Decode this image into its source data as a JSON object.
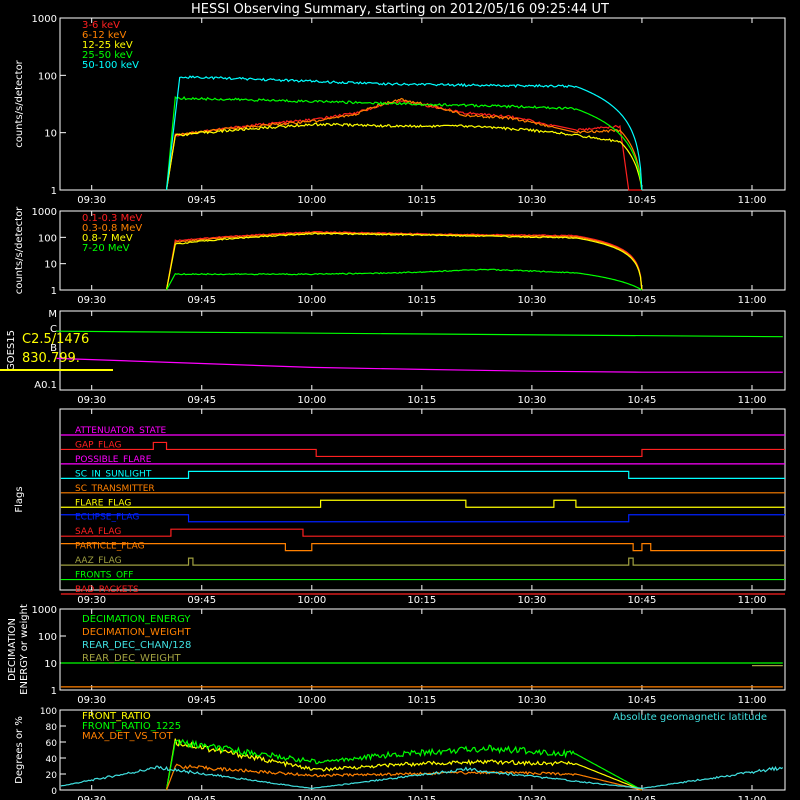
{
  "title": "HESSI Observing Summary, starting on 2012/05/16 09:25:44 UT",
  "time_ticks": [
    "09:30",
    "09:45",
    "10:00",
    "10:15",
    "10:30",
    "10:45",
    "11:00"
  ],
  "colors": {
    "background": "#000000",
    "axes": "#ffffff",
    "red": "#ff2020",
    "orange": "#ff8000",
    "yellow": "#ffff00",
    "green": "#00ff00",
    "cyan": "#00ffff",
    "magenta": "#ff00ff",
    "blue": "#0020ff",
    "olive": "#a0a040",
    "lightcyan": "#40e0e0"
  },
  "chart_data": [
    {
      "type": "line",
      "id": "xray",
      "ylabel": "counts/s/detector",
      "yscale": "log",
      "ylim": [
        1,
        1000
      ],
      "yticks": [
        "1",
        "10",
        "100",
        "1000"
      ],
      "series": [
        {
          "name": "3-6 keV",
          "color": "#ff2020",
          "x": [
            9.67,
            9.69,
            10.01,
            10.1,
            10.2,
            10.35,
            10.45,
            10.55,
            10.6,
            10.7,
            10.72,
            10.75
          ],
          "y": [
            1,
            9,
            17,
            22,
            35,
            22,
            19,
            13,
            11,
            13,
            1,
            1
          ]
        },
        {
          "name": "6-12 keV",
          "color": "#ff8000",
          "x": [
            9.67,
            9.69,
            10.01,
            10.1,
            10.2,
            10.35,
            10.45,
            10.55,
            10.6,
            10.7,
            10.75
          ],
          "y": [
            1,
            9,
            16,
            21,
            38,
            20,
            18,
            12,
            10,
            11,
            1
          ]
        },
        {
          "name": "12-25 keV",
          "color": "#ffff00",
          "x": [
            9.67,
            9.69,
            10.01,
            10.2,
            10.35,
            10.5,
            10.6,
            10.7,
            10.75
          ],
          "y": [
            1,
            9,
            14,
            13,
            13,
            11,
            9,
            7,
            1
          ]
        },
        {
          "name": "25-50 keV",
          "color": "#00ff00",
          "x": [
            9.67,
            9.69,
            10.01,
            10.2,
            10.35,
            10.5,
            10.6,
            10.75
          ],
          "y": [
            1,
            40,
            35,
            32,
            30,
            28,
            26,
            1
          ]
        },
        {
          "name": "50-100 keV",
          "color": "#00ffff",
          "x": [
            9.67,
            9.7,
            10.01,
            10.15,
            10.3,
            10.45,
            10.6,
            10.75
          ],
          "y": [
            1,
            95,
            78,
            72,
            68,
            66,
            64,
            1
          ]
        }
      ]
    },
    {
      "type": "line",
      "id": "gamma",
      "ylabel": "counts/s/detector",
      "yscale": "log",
      "ylim": [
        1,
        1000
      ],
      "yticks": [
        "1",
        "10",
        "100",
        "1000"
      ],
      "series": [
        {
          "name": "0.1-0.3 MeV",
          "color": "#ff2020",
          "x": [
            9.67,
            9.69,
            10.01,
            10.3,
            10.6,
            10.75
          ],
          "y": [
            1,
            75,
            160,
            130,
            115,
            1
          ]
        },
        {
          "name": "0.3-0.8 MeV",
          "color": "#ff8000",
          "x": [
            9.67,
            9.69,
            10.01,
            10.3,
            10.6,
            10.75
          ],
          "y": [
            1,
            65,
            150,
            125,
            105,
            1
          ]
        },
        {
          "name": "0.8-7 MeV",
          "color": "#ffff00",
          "x": [
            9.67,
            9.69,
            10.01,
            10.3,
            10.6,
            10.75
          ],
          "y": [
            1,
            55,
            140,
            118,
            95,
            1
          ]
        },
        {
          "name": "7-20 MeV",
          "color": "#00ff00",
          "x": [
            9.67,
            9.69,
            10.01,
            10.2,
            10.4,
            10.6,
            10.75
          ],
          "y": [
            1,
            4,
            4,
            4.5,
            6,
            4.5,
            1
          ]
        }
      ]
    },
    {
      "type": "line",
      "id": "goes",
      "ylabel": "GOES15",
      "yscale": "log",
      "ytick_labels": [
        "A0.1",
        "B",
        "C",
        "M"
      ],
      "annotations": [
        "C2.5/1476",
        "830.799."
      ],
      "series": [
        {
          "name": "GOES long",
          "color": "#00ff00",
          "x": [
            9.42,
            11.07
          ],
          "y": [
            9.5e-06,
            5e-06
          ]
        },
        {
          "name": "GOES short",
          "color": "#ff00ff",
          "x": [
            9.42,
            9.75,
            10.0,
            10.25,
            10.5,
            10.75,
            11.07
          ],
          "y": [
            4e-07,
            2.2e-07,
            1.4e-07,
            1.1e-07,
            9e-08,
            8e-08,
            8e-08
          ]
        }
      ]
    },
    {
      "type": "flags",
      "id": "flags",
      "ylabel": "Flags",
      "series": [
        {
          "name": "ATTENUATOR_STATE",
          "color": "#ff00ff",
          "x": [
            9.43
          ],
          "y": [
            0
          ]
        },
        {
          "name": "GAP_FLAG",
          "color": "#ff2020",
          "x": [
            9.43,
            9.64,
            9.67,
            10.01,
            10.75
          ],
          "y": [
            0,
            1,
            0,
            -1,
            0
          ]
        },
        {
          "name": "POSSIBLE_FLARE",
          "color": "#ff00ff",
          "x": [
            9.43
          ],
          "y": [
            0
          ]
        },
        {
          "name": "SC_IN_SUNLIGHT",
          "color": "#00ffff",
          "x": [
            9.43,
            9.72,
            10.72
          ],
          "y": [
            0,
            1,
            0
          ]
        },
        {
          "name": "SC_TRANSMITTER",
          "color": "#ff8000",
          "x": [
            9.43
          ],
          "y": [
            0
          ]
        },
        {
          "name": "FLARE_FLAG",
          "color": "#ffff00",
          "x": [
            9.43,
            10.02,
            10.35,
            10.55,
            10.6
          ],
          "y": [
            0,
            1,
            0,
            1,
            0
          ]
        },
        {
          "name": "ECLIPSE_FLAG",
          "color": "#0020ff",
          "x": [
            9.43,
            9.72,
            10.72
          ],
          "y": [
            1,
            0,
            1
          ]
        },
        {
          "name": "SAA_FLAG",
          "color": "#ff2020",
          "x": [
            9.43,
            9.68,
            9.98
          ],
          "y": [
            0,
            1,
            0
          ]
        },
        {
          "name": "PARTICLE_FLAG",
          "color": "#ff8000",
          "x": [
            9.43,
            9.94,
            10.0,
            10.73,
            10.75,
            10.77
          ],
          "y": [
            1,
            0,
            1,
            0,
            1,
            0
          ]
        },
        {
          "name": "AAZ_FLAG",
          "color": "#a0a040",
          "x": [
            9.43,
            9.72,
            9.73,
            10.72,
            10.73
          ],
          "y": [
            0,
            1,
            0,
            1,
            0
          ]
        },
        {
          "name": "FRONTS_OFF",
          "color": "#00ff00",
          "x": [
            9.43
          ],
          "y": [
            0
          ]
        },
        {
          "name": "BAD_PACKETS",
          "color": "#ff2020",
          "x": [
            9.43
          ],
          "y": [
            0
          ]
        }
      ]
    },
    {
      "type": "line",
      "id": "decimation",
      "ylabel": "DECIMATION ENERGY or weight",
      "yscale": "log",
      "ylim": [
        1,
        1000
      ],
      "yticks": [
        "1",
        "10",
        "100",
        "1000"
      ],
      "series": [
        {
          "name": "DECIMATION_ENERGY",
          "color": "#00ff00",
          "x": [
            9.43,
            11.07
          ],
          "y": [
            10,
            10
          ]
        },
        {
          "name": "DECIMATION_WEIGHT",
          "color": "#ff8000",
          "x": [
            9.43,
            11.07
          ],
          "y": [
            1.3,
            1.3
          ]
        },
        {
          "name": "REAR_DEC_CHAN/128",
          "color": "#40e0e0",
          "x": [
            9.43
          ],
          "y": [
            1
          ]
        },
        {
          "name": "REAR_DEC_WEIGHT",
          "color": "#a0a040",
          "x": [
            11.0,
            11.07
          ],
          "y": [
            8,
            8
          ]
        }
      ]
    },
    {
      "type": "line",
      "id": "ratio",
      "ylabel": "Degrees or %",
      "ylim": [
        0,
        100
      ],
      "yticks": [
        "0",
        "20",
        "40",
        "60",
        "80",
        "100"
      ],
      "annotations": [
        "Absolute geomagnetic latitude"
      ],
      "series": [
        {
          "name": "FRONT_RATIO",
          "color": "#ffff00",
          "x": [
            9.67,
            9.69,
            10.01,
            10.2,
            10.4,
            10.6,
            10.75
          ],
          "y": [
            0,
            60,
            25,
            32,
            35,
            33,
            0
          ]
        },
        {
          "name": "FRONT_RATIO_1225",
          "color": "#00ff00",
          "x": [
            9.67,
            9.69,
            10.01,
            10.2,
            10.4,
            10.6,
            10.75
          ],
          "y": [
            0,
            60,
            35,
            45,
            52,
            45,
            0
          ]
        },
        {
          "name": "MAX_DET_VS_TOT",
          "color": "#ff8000",
          "x": [
            9.67,
            9.69,
            10.01,
            10.2,
            10.4,
            10.6,
            10.75
          ],
          "y": [
            0,
            30,
            18,
            20,
            22,
            20,
            0
          ]
        },
        {
          "name": "Absolute geomagnetic latitude",
          "color": "#40e0e0",
          "x": [
            9.43,
            9.65,
            10.0,
            10.35,
            10.75,
            11.07
          ],
          "y": [
            5,
            28,
            2,
            26,
            2,
            28
          ]
        }
      ]
    }
  ]
}
